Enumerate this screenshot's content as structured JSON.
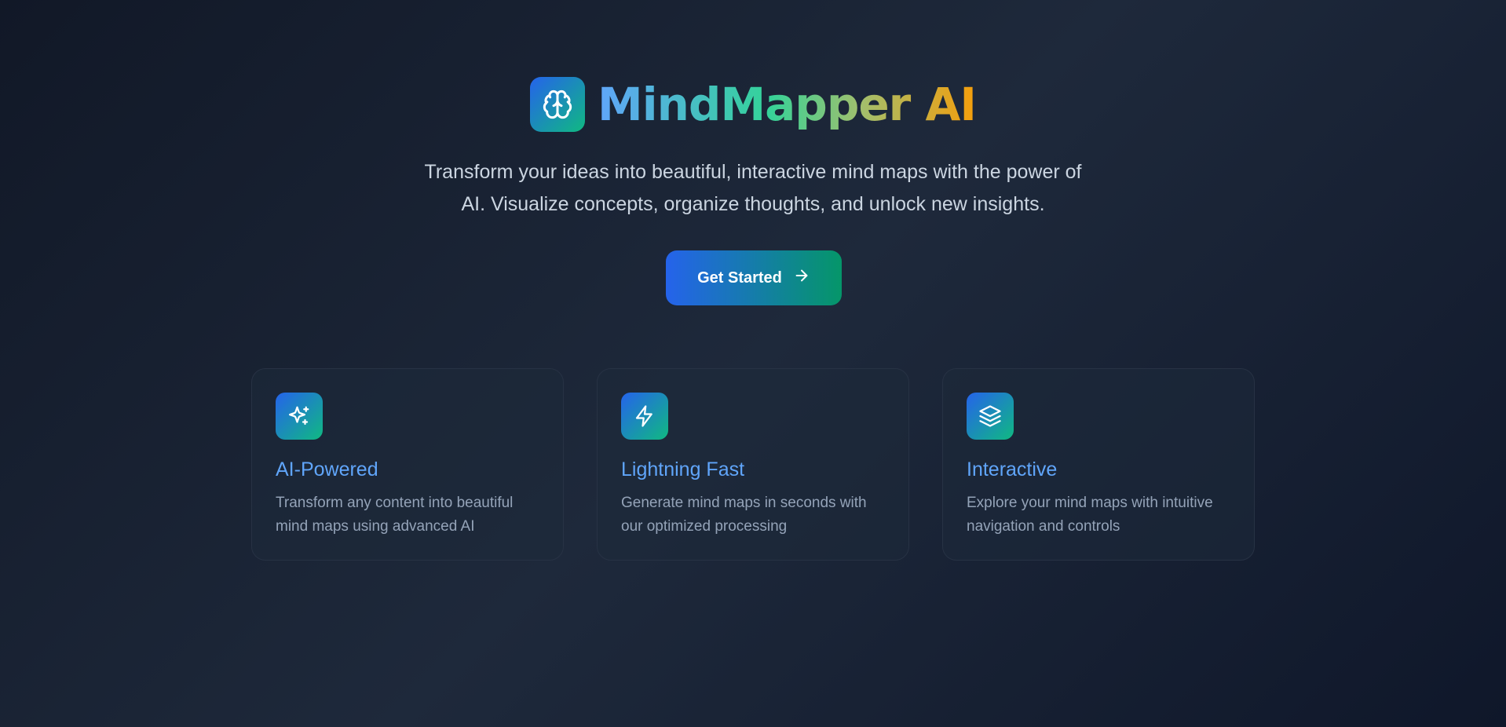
{
  "brand": {
    "title": "MindMapper AI",
    "logo_icon": "brain-icon"
  },
  "hero": {
    "tagline": "Transform your ideas into beautiful, interactive mind maps with the power of AI. Visualize concepts, organize thoughts, and unlock new insights.",
    "cta_label": "Get Started",
    "cta_icon": "arrow-right-icon"
  },
  "features": [
    {
      "title": "AI-Powered",
      "description": "Transform any content into beautiful mind maps using advanced AI",
      "icon": "sparkles-icon"
    },
    {
      "title": "Lightning Fast",
      "description": "Generate mind maps in seconds with our optimized processing",
      "icon": "lightning-icon"
    },
    {
      "title": "Interactive",
      "description": "Explore your mind maps with intuitive navigation and controls",
      "icon": "layers-icon"
    }
  ],
  "colors": {
    "background": "#111827",
    "accent_blue": "#2563eb",
    "accent_green": "#10b981",
    "title_orange": "#f59e0b",
    "card_title": "#60a5fa"
  }
}
